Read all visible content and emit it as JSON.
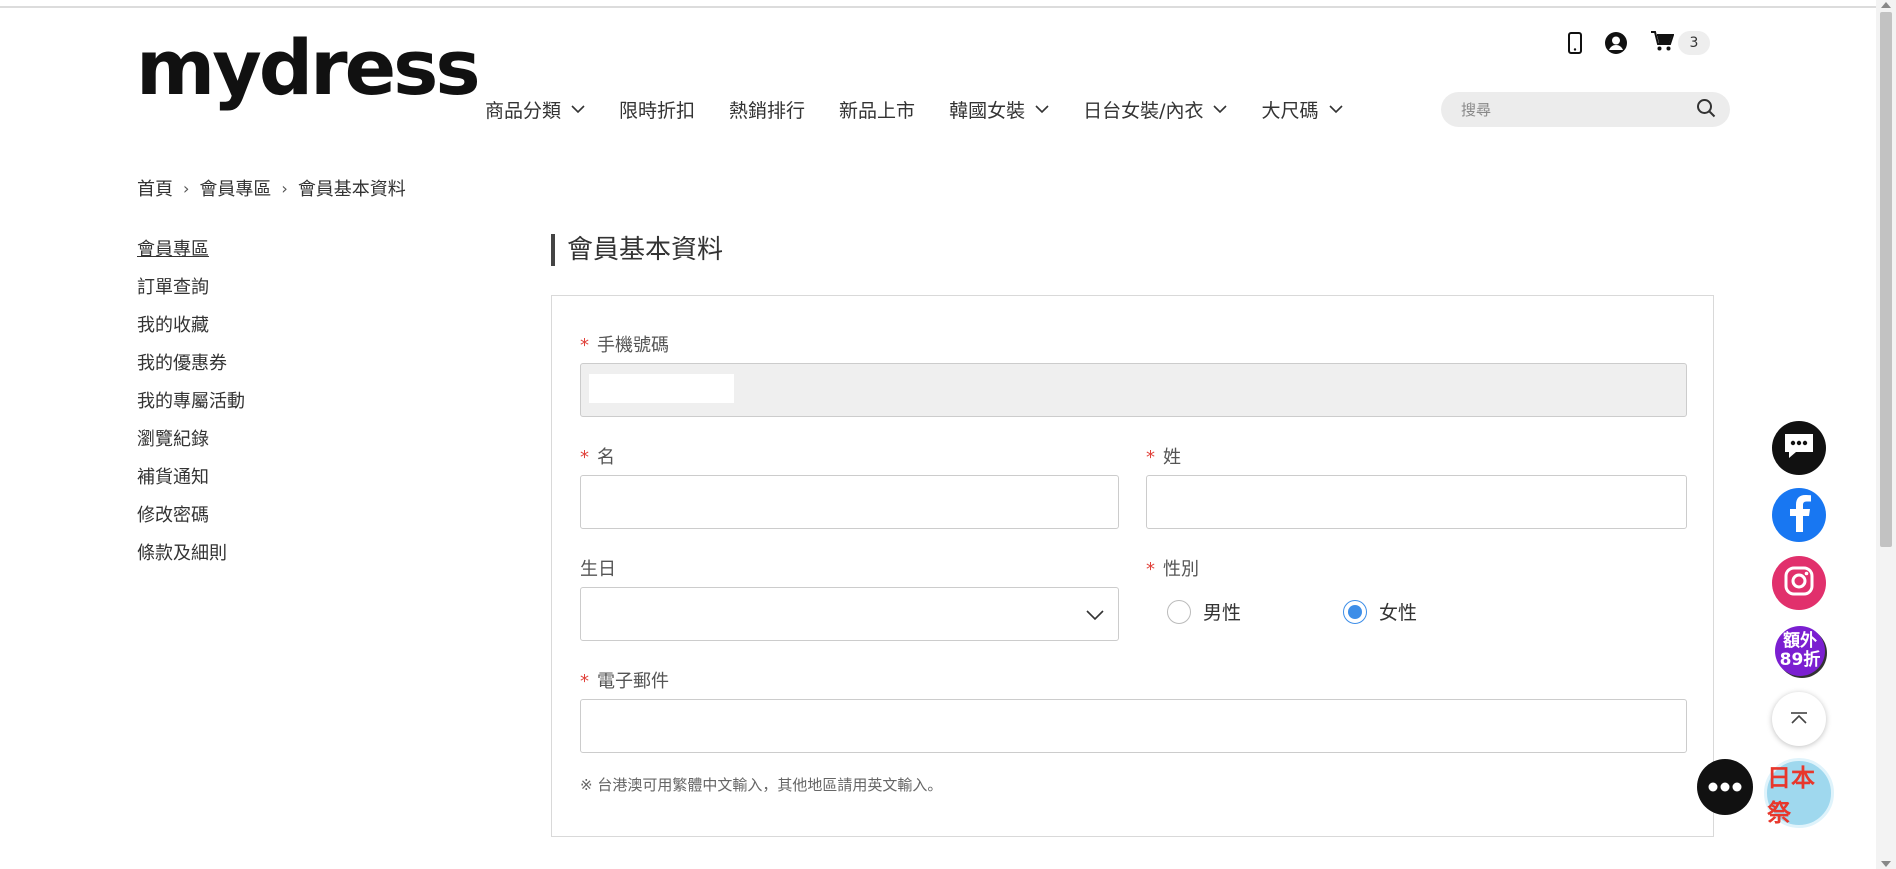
{
  "brand": {
    "logo": "mydress"
  },
  "nav": [
    {
      "label": "商品分類",
      "dropdown": true
    },
    {
      "label": "限時折扣",
      "dropdown": false
    },
    {
      "label": "熱銷排行",
      "dropdown": false
    },
    {
      "label": "新品上市",
      "dropdown": false
    },
    {
      "label": "韓國女裝",
      "dropdown": true
    },
    {
      "label": "日台女裝/內衣",
      "dropdown": true
    },
    {
      "label": "大尺碼",
      "dropdown": true
    }
  ],
  "header": {
    "cart_count": "3",
    "search_placeholder": "搜尋"
  },
  "breadcrumb": [
    "首頁",
    "會員專區",
    "會員基本資料"
  ],
  "sidebar": {
    "items": [
      {
        "label": "會員專區",
        "active": true
      },
      {
        "label": "訂單查詢"
      },
      {
        "label": "我的收藏"
      },
      {
        "label": "我的優惠券"
      },
      {
        "label": "我的專屬活動"
      },
      {
        "label": "瀏覽紀錄"
      },
      {
        "label": "補貨通知"
      },
      {
        "label": "修改密碼"
      },
      {
        "label": "條款及細則"
      }
    ]
  },
  "page_title": "會員基本資料",
  "form": {
    "required_mark": "*",
    "phone": {
      "label": "手機號碼",
      "value": ""
    },
    "first_name": {
      "label": "名",
      "value": ""
    },
    "last_name": {
      "label": "姓",
      "value": ""
    },
    "birthday": {
      "label": "生日",
      "value": ""
    },
    "gender": {
      "label": "性別",
      "options": [
        "男性",
        "女性"
      ],
      "selected": "女性"
    },
    "email": {
      "label": "電子郵件",
      "value": ""
    },
    "note": "※ 台港澳可用繁體中文輸入，其他地區請用英文輸入。"
  },
  "floating": {
    "promo_label": "額外89折",
    "promo_line1": "額外",
    "promo_line2": "89折",
    "festival_label": "日本祭"
  },
  "colors": {
    "required": "#e0413a",
    "radio_selected": "#3d8ee8",
    "facebook": "#1877f2",
    "instagram": "#e1306c",
    "promo": "#7b1fd1",
    "festival_bg": "#9fd8ee",
    "festival_text": "#e8372c"
  }
}
